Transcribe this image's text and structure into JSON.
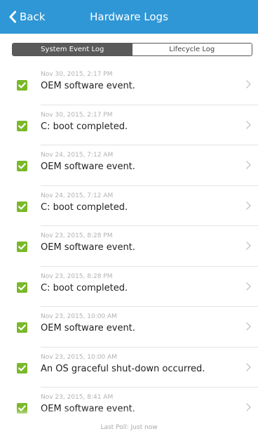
{
  "nav": {
    "back_label": "Back",
    "title": "Hardware Logs"
  },
  "tabs": [
    {
      "label": "System Event Log",
      "selected": true
    },
    {
      "label": "Lifecycle Log",
      "selected": false
    }
  ],
  "logs": [
    {
      "timestamp": "Nov 30, 2015, 2:17 PM",
      "message": "OEM software event.",
      "status": "ok"
    },
    {
      "timestamp": "Nov 30, 2015, 2:17 PM",
      "message": "C: boot completed.",
      "status": "ok"
    },
    {
      "timestamp": "Nov 24, 2015, 7:12 AM",
      "message": "OEM software event.",
      "status": "ok"
    },
    {
      "timestamp": "Nov 24, 2015, 7:12 AM",
      "message": "C: boot completed.",
      "status": "ok"
    },
    {
      "timestamp": "Nov 23, 2015, 8:28 PM",
      "message": "OEM software event.",
      "status": "ok"
    },
    {
      "timestamp": "Nov 23, 2015, 8:28 PM",
      "message": "C: boot completed.",
      "status": "ok"
    },
    {
      "timestamp": "Nov 23, 2015, 10:00 AM",
      "message": "OEM software event.",
      "status": "ok"
    },
    {
      "timestamp": "Nov 23, 2015, 10:00 AM",
      "message": "An OS graceful shut-down occurred.",
      "status": "ok"
    },
    {
      "timestamp": "Nov 23, 2015, 8:41 AM",
      "message": "OEM software event.",
      "status": "ok"
    }
  ],
  "footer": {
    "last_poll": "Last Poll: Just now"
  },
  "icons": {
    "back": "chevron-left-icon",
    "status": "checkbox-checked-icon",
    "disclosure": "chevron-right-icon"
  },
  "colors": {
    "nav_background": "#2f97d6",
    "check_green": "#7ab829",
    "segment_active": "#5a5a5a"
  }
}
